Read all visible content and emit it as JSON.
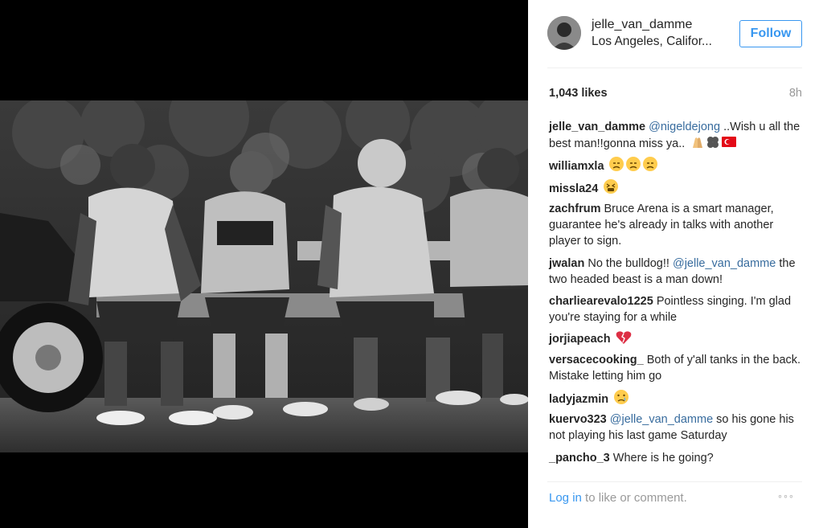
{
  "post": {
    "username": "jelle_van_damme",
    "location": "Los Angeles, Califor...",
    "follow_label": "Follow",
    "likes": "1,043 likes",
    "age": "8h"
  },
  "comments": [
    {
      "user": "jelle_van_damme",
      "parts": [
        {
          "t": "mention",
          "v": "@nigeldejong"
        },
        {
          "t": "text",
          "v": " ..Wish u all the best man!!gonna miss ya.."
        }
      ],
      "emoji": [
        "pray",
        "clover",
        "turkey-flag"
      ]
    },
    {
      "user": "williamxla",
      "parts": [],
      "emoji": [
        "disappointed",
        "disappointed",
        "disappointed"
      ]
    },
    {
      "user": "missla24",
      "parts": [],
      "emoji": [
        "tired-face"
      ]
    },
    {
      "user": "zachfrum",
      "parts": [
        {
          "t": "text",
          "v": " Bruce Arena is a smart manager, guarantee he's already in talks with another player to sign."
        }
      ],
      "emoji": []
    },
    {
      "user": "jwalan",
      "parts": [
        {
          "t": "text",
          "v": " No the bulldog!! "
        },
        {
          "t": "mention",
          "v": "@jelle_van_damme"
        },
        {
          "t": "text",
          "v": " the two headed beast is a man down!"
        }
      ],
      "emoji": []
    },
    {
      "user": "charliearevalo1225",
      "parts": [
        {
          "t": "text",
          "v": " Pointless singing. I'm glad you're staying for a while"
        }
      ],
      "emoji": []
    },
    {
      "user": "jorjiapeach",
      "parts": [],
      "emoji": [
        "broken-heart"
      ]
    },
    {
      "user": "versacecooking_",
      "parts": [
        {
          "t": "text",
          "v": " Both of y'all tanks in the back. Mistake letting him go"
        }
      ],
      "emoji": []
    },
    {
      "user": "ladyjazmin",
      "parts": [],
      "emoji": [
        "crying-face"
      ]
    },
    {
      "user": "kuervo323",
      "parts": [
        {
          "t": "mention",
          "v": "@jelle_van_damme"
        },
        {
          "t": "text",
          "v": " so his gone his not playing his last game Saturday"
        }
      ],
      "emoji": []
    },
    {
      "user": "_pancho_3",
      "parts": [
        {
          "t": "text",
          "v": " Where is he going?"
        }
      ],
      "emoji": []
    }
  ],
  "footer": {
    "login_link": "Log in",
    "login_rest": " to like or comment.",
    "more": "◦◦◦"
  },
  "icons": {
    "more": "more-options-icon"
  },
  "colors": {
    "accent": "#3897f0",
    "mention": "#386c9e",
    "muted": "#999999",
    "text": "#262626"
  }
}
